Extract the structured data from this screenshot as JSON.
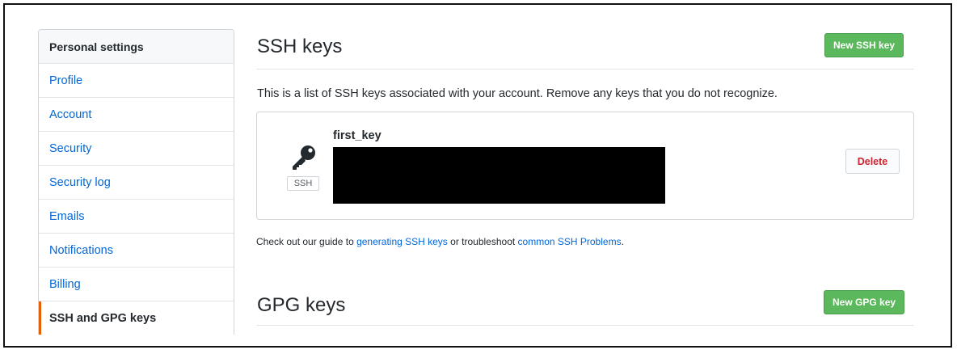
{
  "sidebar": {
    "header": "Personal settings",
    "items": [
      {
        "label": "Profile"
      },
      {
        "label": "Account"
      },
      {
        "label": "Security"
      },
      {
        "label": "Security log"
      },
      {
        "label": "Emails"
      },
      {
        "label": "Notifications"
      },
      {
        "label": "Billing"
      },
      {
        "label": "SSH and GPG keys",
        "selected": true
      }
    ]
  },
  "ssh_section": {
    "title": "SSH keys",
    "new_button": "New SSH key",
    "description": "This is a list of SSH keys associated with your account. Remove any keys that you do not recognize.",
    "keys": [
      {
        "title": "first_key",
        "type_label": "SSH",
        "icon": "key-icon",
        "delete_label": "Delete"
      }
    ],
    "guide": {
      "prefix": "Check out our guide to ",
      "link1": "generating SSH keys",
      "middle": " or troubleshoot ",
      "link2": "common SSH Problems",
      "suffix": "."
    }
  },
  "gpg_section": {
    "title": "GPG keys",
    "new_button": "New GPG key"
  },
  "colors": {
    "link": "#0366d6",
    "green_button": "#5cb85c",
    "danger": "#cb2431",
    "selected_marker": "#e36209"
  }
}
